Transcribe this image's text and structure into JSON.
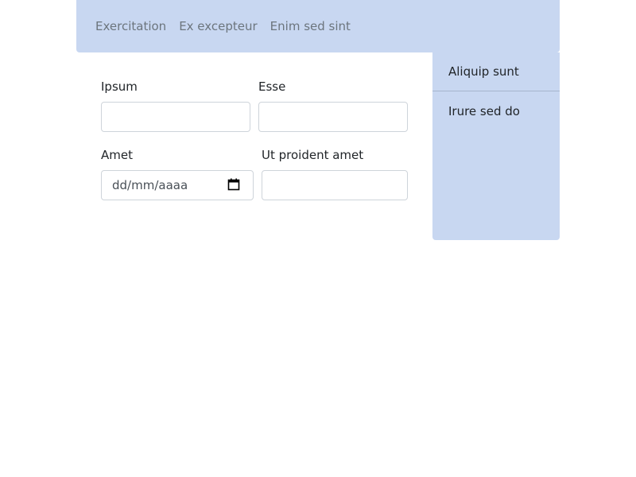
{
  "nav": {
    "links": [
      "Exercitation",
      "Ex excepteur",
      "Enim sed sint"
    ]
  },
  "form": {
    "fields": [
      {
        "label": "Ipsum",
        "value": ""
      },
      {
        "label": "Esse",
        "value": ""
      },
      {
        "label": "Amet",
        "placeholder": "dd/mm/aaaa"
      },
      {
        "label": "Ut proident amet",
        "value": ""
      }
    ]
  },
  "sidebar": {
    "items": [
      {
        "label": "Aliquip sunt"
      },
      {
        "label": "Irure sed do"
      }
    ]
  },
  "colors": {
    "panel_bg": "#c8d7f1",
    "nav_link": "#6c757d",
    "input_border": "#ced4da"
  },
  "icons": {
    "date_picker": "calendar-icon"
  }
}
